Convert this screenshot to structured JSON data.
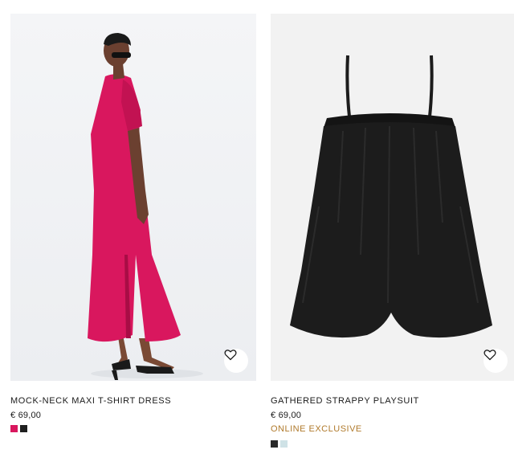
{
  "products": [
    {
      "name": "MOCK-NECK MAXI T-SHIRT DRESS",
      "price": "€ 69,00",
      "badge": "",
      "image_icon": "pink-maxi-dress-photo",
      "favorite_icon": "heart-icon",
      "swatches": [
        {
          "color": "#d9175e",
          "name": "pink"
        },
        {
          "color": "#1f1f1f",
          "name": "black"
        }
      ]
    },
    {
      "name": "GATHERED STRAPPY PLAYSUIT",
      "price": "€ 69,00",
      "badge": "ONLINE EXCLUSIVE",
      "image_icon": "black-playsuit-photo",
      "favorite_icon": "heart-icon",
      "swatches": [
        {
          "color": "#2a2a2a",
          "name": "black"
        },
        {
          "color": "#cfe2e6",
          "name": "light-blue"
        }
      ]
    }
  ],
  "colors": {
    "badge": "#b07a2c",
    "dress": "#d9175e",
    "playsuit": "#1c1c1c"
  }
}
